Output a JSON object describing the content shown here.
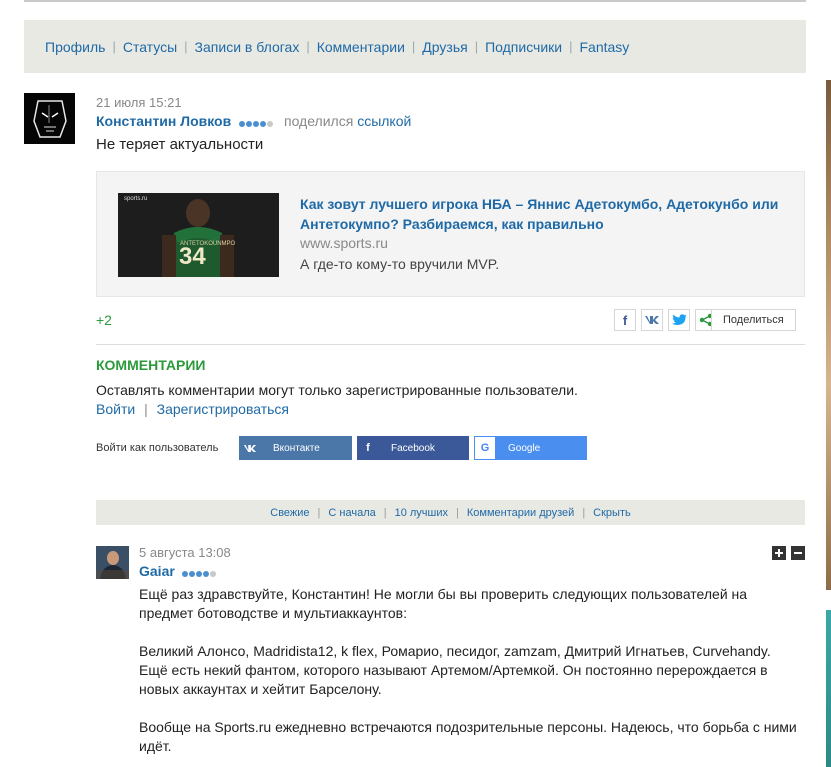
{
  "profile_nav": {
    "items": [
      "Профиль",
      "Статусы",
      "Записи в блогах",
      "Комментарии",
      "Друзья",
      "Подписчики",
      "Fantasy"
    ]
  },
  "post": {
    "date": "21 июля 15:21",
    "author": "Константин Ловков",
    "action": "поделился",
    "action_link": "ссылкой",
    "text": "Не теряет актуальности",
    "link": {
      "thumb_brand": "sports.ru",
      "thumb_number": "34",
      "title": "Как зовут лучшего игрока НБА – Яннис Адетокумбо, Адетокунбо или Антетокумпо? Разбираемся, как правильно",
      "domain": "www.sports.ru",
      "description": "А где-то кому-то вручили MVP."
    },
    "rating": "+2",
    "share": {
      "fb_icon": "f",
      "vk_icon": "vk",
      "tw_icon": "tw",
      "share_icon": "share-icon",
      "label": "Поделиться"
    }
  },
  "comments_section": {
    "title": "КОММЕНТАРИИ",
    "notice": "Оставлять комментарии могут только зарегистрированные пользователи.",
    "login_label": "Войти",
    "register_label": "Зарегистрироваться",
    "login_as": "Войти как пользователь",
    "social": {
      "vk": "Вконтакте",
      "fb": "Facebook",
      "google": "Google"
    },
    "filters": [
      "Свежие",
      "С начала",
      "10 лучших",
      "Комментарии друзей",
      "Скрыть"
    ]
  },
  "comment": {
    "date": "5 августа 13:08",
    "author": "Gaiar",
    "paragraphs": [
      "Ещё раз здравствуйте, Константин! Не могли бы вы проверить следующих пользователей на предмет ботоводстве и мультиаккаунтов:",
      "Великий Алонсо, Madridista12, k flex, Ромарио, песидог, zamzam, Дмитрий Игнатьев, Curvehandy. Ещё есть некий фантом, которого называют Артемом/Артемкой. Он постоянно перерождается в новых аккаунтах и хейтит Барселону.",
      "Вообще на Sports.ru ежедневно встречаются подозрительные персоны. Надеюсь, что борьба с ними идёт."
    ]
  },
  "colors": {
    "link": "#1f6aa6",
    "green": "#2b9a3a",
    "nav_bg": "#e9e9e4"
  }
}
